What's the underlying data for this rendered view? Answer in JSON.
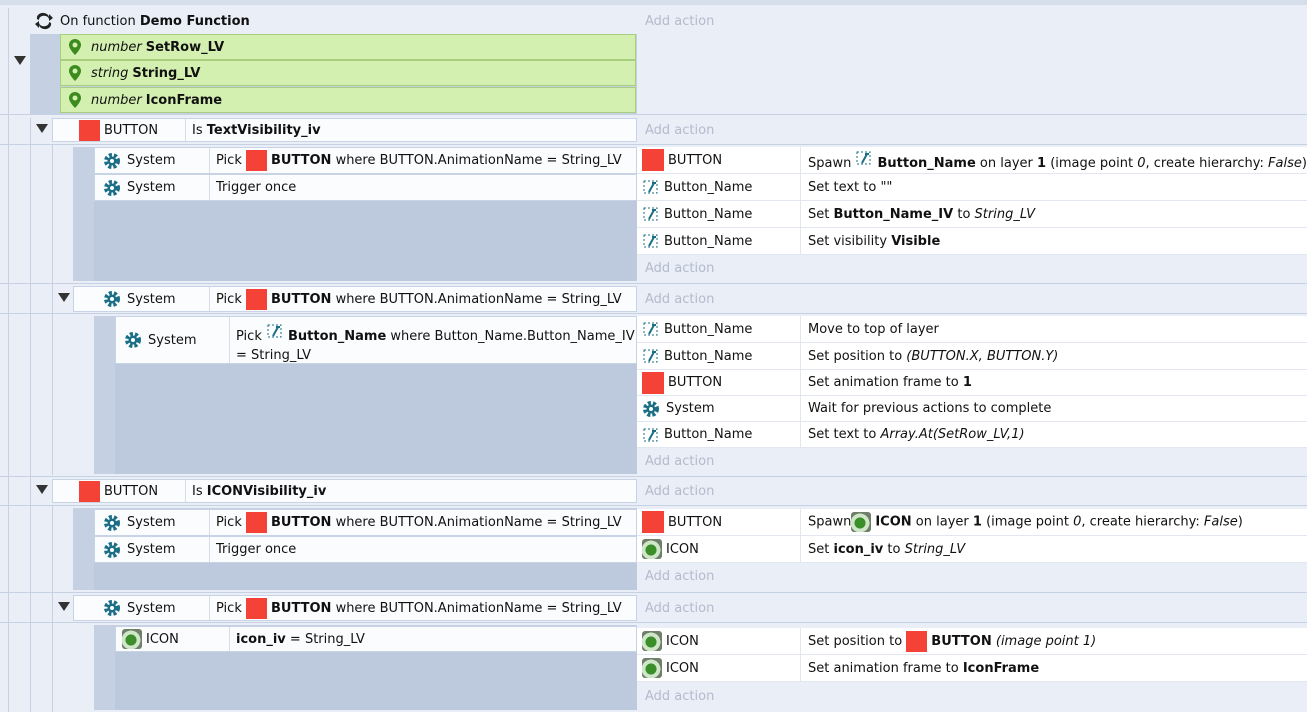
{
  "function_header": {
    "prefix": "On function",
    "name": "Demo Function",
    "params": [
      {
        "type": "number",
        "name": "SetRow_LV"
      },
      {
        "type": "string",
        "name": "String_LV"
      },
      {
        "type": "number",
        "name": "IconFrame"
      }
    ]
  },
  "add_action": "Add action",
  "events": {
    "e1": {
      "obj": "BUTTON",
      "pre": "Is",
      "bold": "TextVisibility_iv"
    },
    "e1a": {
      "c1": {
        "obj": "System",
        "pre": "Pick",
        "bold": "BUTTON",
        "post": "where BUTTON.AnimationName = String_LV"
      },
      "c2": {
        "obj": "System",
        "txt": "Trigger once"
      },
      "a1": {
        "obj": "BUTTON",
        "pre": "Spawn",
        "bold": "Button_Name",
        "mid": "on layer",
        "num": "1",
        "post1": "(image point",
        "ip": "0",
        "post2": ", create hierarchy:",
        "val": "False",
        "end": ")"
      },
      "a2": {
        "obj": "Button_Name",
        "txt": "Set text to \"\""
      },
      "a3": {
        "obj": "Button_Name",
        "pre": "Set",
        "bold": "Button_Name_IV",
        "mid": "to",
        "it": "String_LV"
      },
      "a4": {
        "obj": "Button_Name",
        "pre": "Set visibility",
        "bold": "Visible"
      }
    },
    "e1b": {
      "c1": {
        "obj": "System",
        "pre": "Pick",
        "bold": "BUTTON",
        "post": "where BUTTON.AnimationName = String_LV"
      }
    },
    "e1b1": {
      "c1": {
        "obj": "System",
        "pre": "Pick",
        "bold": "Button_Name",
        "post": "where Button_Name.Button_Name_IV",
        "line2": "= String_LV"
      },
      "a1": {
        "obj": "Button_Name",
        "txt": "Move to top of layer"
      },
      "a2": {
        "obj": "Button_Name",
        "pre": "Set position to",
        "it": "(BUTTON.X, BUTTON.Y)"
      },
      "a3": {
        "obj": "BUTTON",
        "pre": "Set animation frame to",
        "bold": "1"
      },
      "a4": {
        "obj": "System",
        "txt": "Wait for previous actions to complete"
      },
      "a5": {
        "obj": "Button_Name",
        "pre": "Set text to",
        "it": "Array.At(SetRow_LV,1)"
      }
    },
    "e2": {
      "obj": "BUTTON",
      "pre": "Is",
      "bold": "ICONVisibility_iv"
    },
    "e2a": {
      "c1": {
        "obj": "System",
        "pre": "Pick",
        "bold": "BUTTON",
        "post": "where BUTTON.AnimationName = String_LV"
      },
      "c2": {
        "obj": "System",
        "txt": "Trigger once"
      },
      "a1": {
        "obj": "BUTTON",
        "pre": "Spawn",
        "bold": "ICON",
        "mid": "on layer",
        "num": "1",
        "post1": "(image point",
        "ip": "0",
        "post2": ", create hierarchy:",
        "val": "False",
        "end": ")"
      },
      "a2": {
        "obj": "ICON",
        "pre": "Set",
        "bold": "icon_iv",
        "mid": "to",
        "it": "String_LV"
      }
    },
    "e2b": {
      "c1": {
        "obj": "System",
        "pre": "Pick",
        "bold": "BUTTON",
        "post": "where BUTTON.AnimationName = String_LV"
      }
    },
    "e2b1": {
      "c1": {
        "obj": "ICON",
        "bold": "icon_iv",
        "post": "= String_LV"
      },
      "a1": {
        "obj": "ICON",
        "pre": "Set position to",
        "bold": "BUTTON",
        "it": "(image point 1)"
      },
      "a2": {
        "obj": "ICON",
        "pre": "Set animation frame to",
        "bold": "IconFrame"
      }
    }
  },
  "colors": {
    "object_red": "#f44336",
    "param_green": "#d4f0b0",
    "system_gear": "#1a6f86"
  }
}
